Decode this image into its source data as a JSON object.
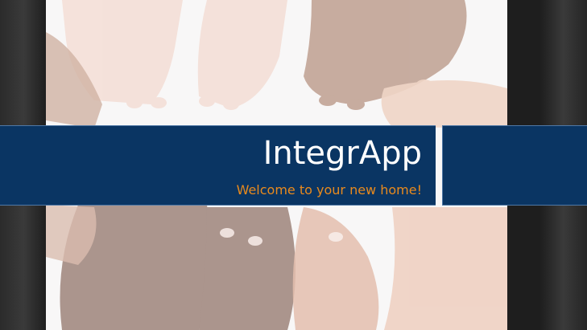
{
  "slide": {
    "title": "IntegrApp",
    "subtitle": "Welcome to your new home!",
    "background_image": "diverse-hands-reaching-photo"
  },
  "colors": {
    "band": "#0a3563",
    "band_border": "#4f78a6",
    "title": "#ffffff",
    "subtitle": "#e98a1d",
    "frame": "#1e1e1e"
  }
}
